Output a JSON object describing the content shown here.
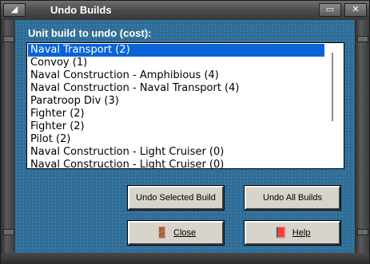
{
  "window": {
    "title": "Undo Builds"
  },
  "dialog": {
    "label": "Unit build to undo (cost):",
    "items": [
      "Naval Transport (2)",
      "Convoy (1)",
      "Naval Construction - Amphibious (4)",
      "Naval Construction - Naval Transport (4)",
      "Paratroop Div (3)",
      "Fighter (2)",
      "Fighter (2)",
      "Pilot (2)",
      "Naval Construction - Light Cruiser (0)",
      "Naval Construction - Light Cruiser (0)"
    ],
    "selected_index": 0
  },
  "buttons": {
    "undo_selected": "Undo Selected Build",
    "undo_all": "Undo All Builds",
    "close": "Close",
    "help": "Help"
  },
  "icons": {
    "close": "exit-door-icon",
    "help": "help-book-icon"
  },
  "colors": {
    "selection": "#0a64d8",
    "background": "#2e6e99"
  }
}
